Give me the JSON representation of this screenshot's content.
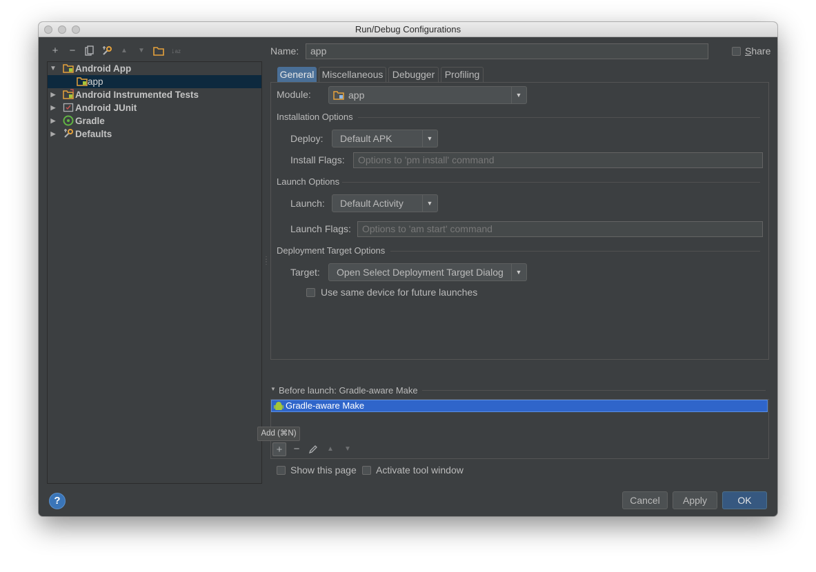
{
  "window": {
    "title": "Run/Debug Configurations"
  },
  "left_toolbar": {
    "buttons": [
      {
        "name": "add",
        "glyph": "+"
      },
      {
        "name": "remove",
        "glyph": "−"
      },
      {
        "name": "copy",
        "glyph": ""
      },
      {
        "name": "edit-defaults",
        "glyph": ""
      },
      {
        "name": "move-up",
        "glyph": "▲"
      },
      {
        "name": "move-down",
        "glyph": "▼"
      },
      {
        "name": "folder",
        "glyph": ""
      },
      {
        "name": "sort",
        "glyph": "↓"
      }
    ]
  },
  "tree": {
    "items": [
      {
        "label": "Android App",
        "expanded": true,
        "icon": "android-app-icon"
      },
      {
        "label": "app",
        "selected": true,
        "icon": "android-app-icon"
      },
      {
        "label": "Android Instrumented Tests",
        "icon": "android-test-icon"
      },
      {
        "label": "Android JUnit",
        "icon": "junit-icon"
      },
      {
        "label": "Gradle",
        "icon": "gradle-icon"
      },
      {
        "label": "Defaults",
        "icon": "wrench-icon"
      }
    ]
  },
  "name_row": {
    "label": "Name:",
    "value": "app",
    "share_label": "Share",
    "share_mnemonic": "S"
  },
  "tabs": [
    {
      "label": "General",
      "active": true
    },
    {
      "label": "Miscellaneous"
    },
    {
      "label": "Debugger"
    },
    {
      "label": "Profiling"
    }
  ],
  "module": {
    "label": "Module:",
    "value": "app"
  },
  "installation": {
    "section": "Installation Options",
    "deploy_label": "Deploy:",
    "deploy_value": "Default APK",
    "install_flags_label": "Install Flags:",
    "install_flags_placeholder": "Options to 'pm install' command"
  },
  "launch": {
    "section": "Launch Options",
    "launch_label": "Launch:",
    "launch_value": "Default Activity",
    "launch_flags_label": "Launch Flags:",
    "launch_flags_placeholder": "Options to 'am start' command"
  },
  "deployment": {
    "section": "Deployment Target Options",
    "target_label": "Target:",
    "target_value": "Open Select Deployment Target Dialog",
    "same_device_label": "Use same device for future launches",
    "same_device_checked": false
  },
  "before_launch": {
    "header": "Before launch: Gradle-aware Make",
    "tasks": [
      {
        "label": "Gradle-aware Make",
        "selected": true
      }
    ],
    "tooltip": "Add (⌘N)"
  },
  "bottom_options": {
    "show_page_label": "Show this page",
    "show_page_checked": false,
    "activate_tool_label": "Activate tool window",
    "activate_tool_checked": false
  },
  "footer": {
    "help": "?",
    "cancel": "Cancel",
    "apply": "Apply",
    "ok": "OK"
  },
  "colors": {
    "background": "#3c3f41",
    "selection": "#2f65ca",
    "tab_active": "#4a6f97",
    "ok_button": "#365880"
  }
}
